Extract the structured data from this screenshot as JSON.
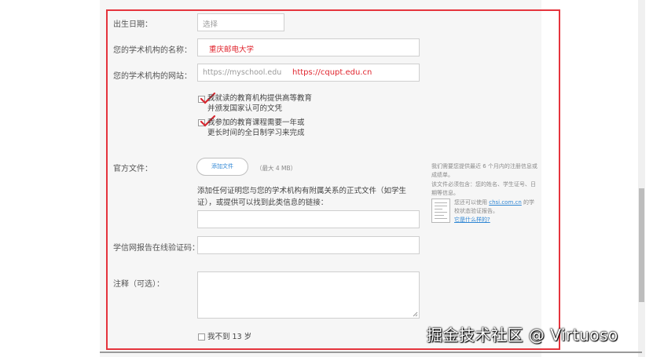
{
  "form": {
    "birthdate": {
      "label": "出生日期：",
      "placeholder": "选择"
    },
    "institution_name": {
      "label": "您的学术机构的名称：",
      "value": "重庆邮电大学"
    },
    "institution_site": {
      "label": "您的学术机构的网站：",
      "placeholder": "https://myschool.edu",
      "annotation": "https://cqupt.edu.cn"
    },
    "check1": {
      "line1": "我就读的教育机构提供高等教育",
      "line2": "并颁发国家认可的文凭"
    },
    "check2": {
      "line1": "我参加的教育课程需要一年或",
      "line2": "更长时间的全日制学习来完成"
    },
    "official_docs": {
      "label": "官方文件：",
      "button": "添加文件",
      "max": "（最大 4 MB）"
    },
    "proof_desc": "添加任何证明您与您的学术机构有附属关系的正式文件（如学生证），或提供可以找到此类信息的链接：",
    "chsi_code": {
      "label": "学信网报告在线验证码："
    },
    "notes": {
      "label": "注释（可选）："
    },
    "under13": {
      "label": "我不到 13 岁"
    }
  },
  "sidebar": {
    "p1": "我们需要您提供最近 6 个月内的注册信息或成绩单。",
    "p2": "该文件必须包含：您的姓名、学生证号、日期等信息。",
    "p3_pre": "您还可以使用 ",
    "p3_link": "chsi.com.cn",
    "p3_post": " 的学校状态验证报告。",
    "p4_link": "它是什么样的?"
  },
  "watermark": "掘金技术社区 @ Virtuoso",
  "colors": {
    "accent_red": "#e5343d",
    "link_blue": "#2e86d4"
  }
}
